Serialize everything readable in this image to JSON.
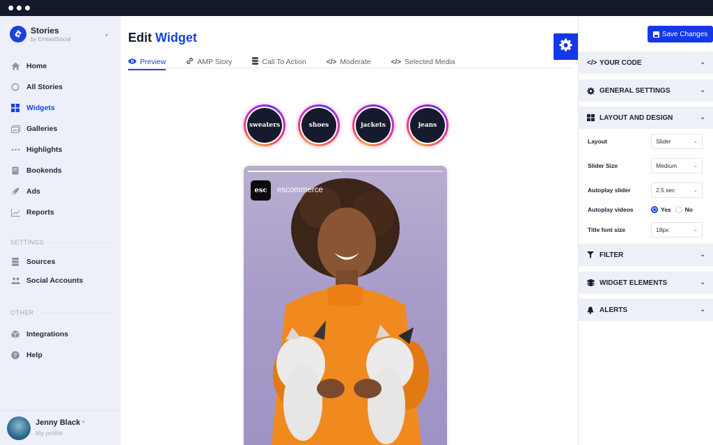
{
  "window": {
    "controls": [
      "dot",
      "dot",
      "dot"
    ]
  },
  "sidebar": {
    "brand": {
      "name": "Stories",
      "subtitle": "by EmbedSocial",
      "icon": "embedsocial-logo-icon"
    },
    "items": [
      {
        "label": "Home",
        "icon": "home-icon",
        "active": false
      },
      {
        "label": "All Stories",
        "icon": "circle-icon",
        "active": false
      },
      {
        "label": "Widgets",
        "icon": "grid-icon",
        "active": true
      },
      {
        "label": "Galleries",
        "icon": "images-icon",
        "active": false
      },
      {
        "label": "Highlights",
        "icon": "dots-icon",
        "active": false
      },
      {
        "label": "Bookends",
        "icon": "book-icon",
        "active": false
      },
      {
        "label": "Ads",
        "icon": "rocket-icon",
        "active": false
      },
      {
        "label": "Reports",
        "icon": "chart-line-icon",
        "active": false
      }
    ],
    "settings_label": "SETTINGS",
    "settings_items": [
      {
        "label": "Sources",
        "icon": "database-icon"
      },
      {
        "label": "Social Accounts",
        "icon": "users-icon"
      }
    ],
    "other_label": "OTHER",
    "other_items": [
      {
        "label": "Integrations",
        "icon": "cube-icon"
      },
      {
        "label": "Help",
        "icon": "question-icon"
      }
    ],
    "profile": {
      "name": "Jenny Black",
      "subtitle": "My profile"
    }
  },
  "main": {
    "title_prefix": "Edit",
    "title_accent": "Widget",
    "tabs": [
      {
        "label": "Preview",
        "icon": "eye-icon",
        "active": true
      },
      {
        "label": "AMP Story",
        "icon": "link-icon",
        "active": false
      },
      {
        "label": "Call To Action",
        "icon": "database-icon",
        "active": false
      },
      {
        "label": "Moderate",
        "icon": "code-icon",
        "active": false
      },
      {
        "label": "Selected Media",
        "icon": "code-icon",
        "active": false
      }
    ],
    "highlights": [
      "sweaters",
      "shoes",
      "jackets",
      "jeans"
    ],
    "story": {
      "account_logo_text": "esc",
      "account_name": "escommerce",
      "progress_percent": 48
    }
  },
  "panel": {
    "save_label": "Save Changes",
    "sections": {
      "your_code": "YOUR CODE",
      "general_settings": "GENERAL SETTINGS",
      "layout_and_design": "LAYOUT AND DESIGN",
      "filter": "FILTER",
      "widget_elements": "WIDGET ELEMENTS",
      "alerts": "ALERTS"
    },
    "layout_fields": {
      "layout": {
        "label": "Layout",
        "value": "Slider"
      },
      "slider_size": {
        "label": "Slider Size",
        "value": "Medium"
      },
      "autoplay_slider": {
        "label": "Autoplay slider",
        "value": "2.5 sec"
      },
      "autoplay_videos": {
        "label": "Autoplay videos",
        "options": [
          "Yes",
          "No"
        ],
        "selected": "Yes"
      },
      "title_font_size": {
        "label": "Title font size",
        "value": "18px"
      }
    }
  },
  "colors": {
    "accent": "#1743e0",
    "button": "#1238e8",
    "titlebar": "#141a2b",
    "sidebar_bg": "#eef0f9"
  }
}
